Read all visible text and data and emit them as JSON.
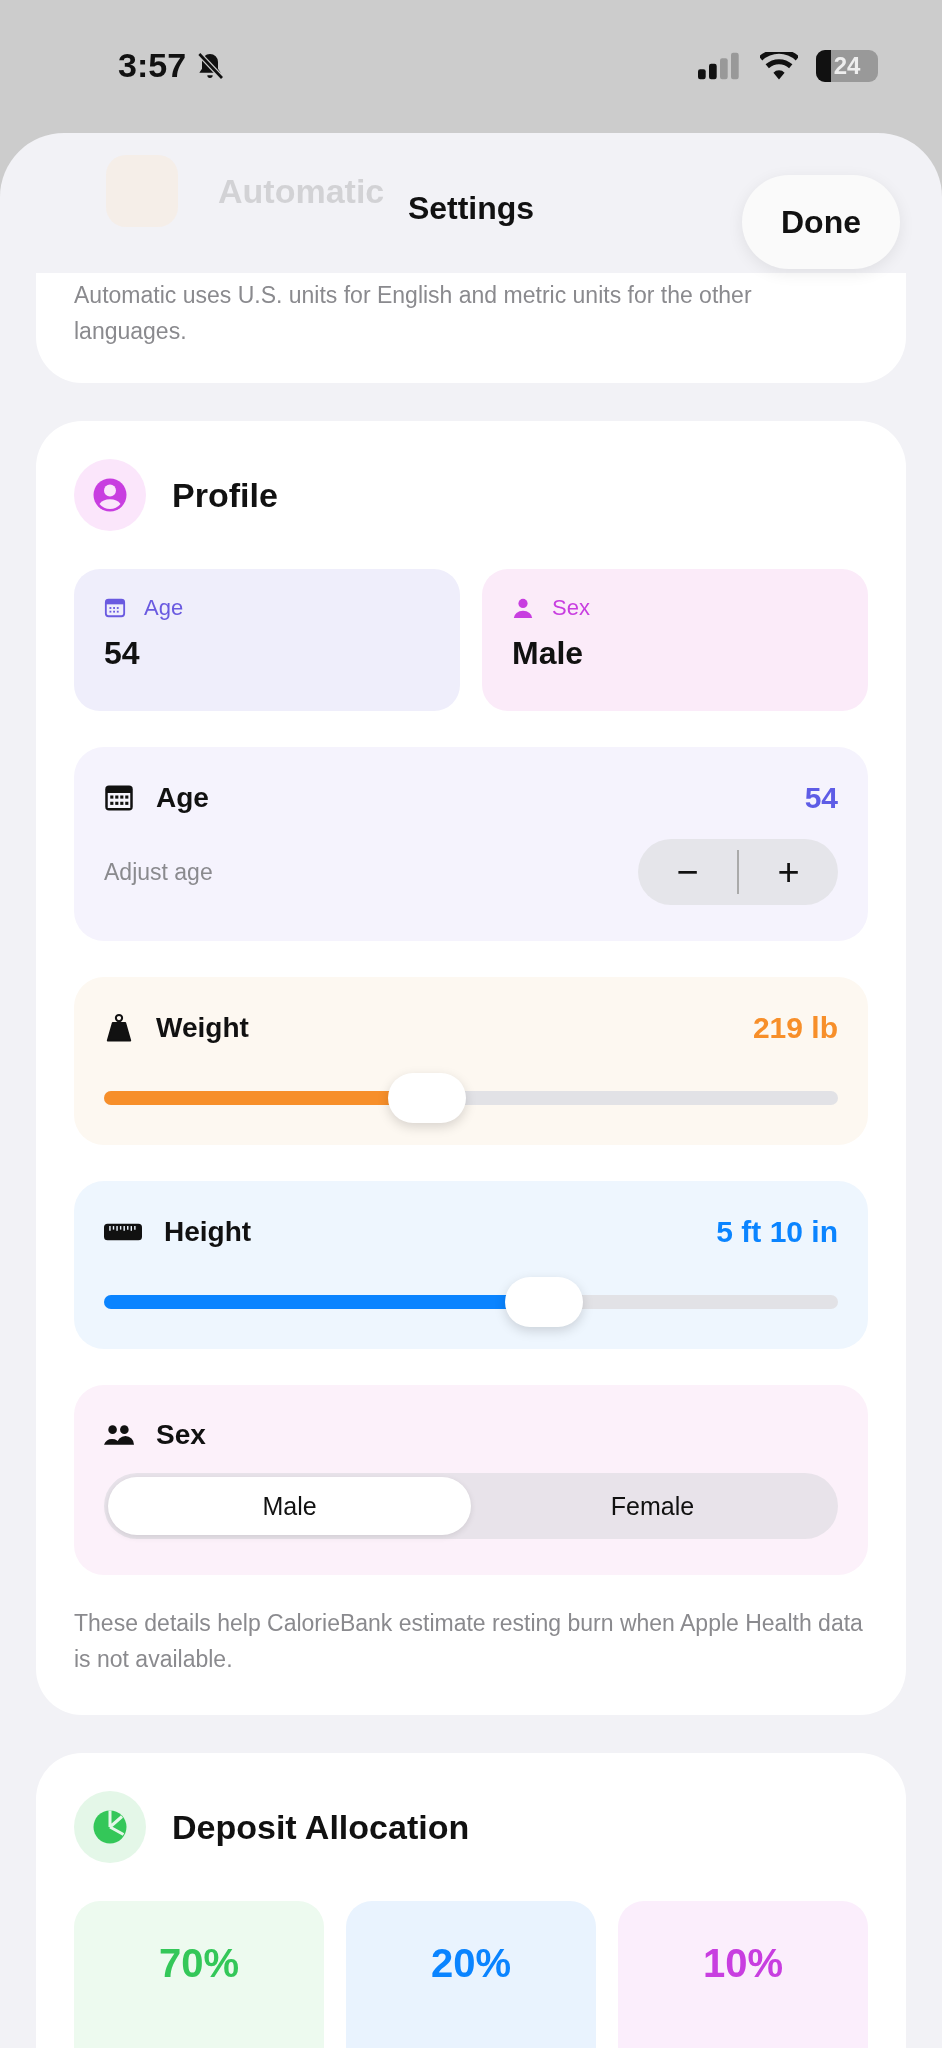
{
  "status_bar": {
    "time": "3:57",
    "battery": "24"
  },
  "header": {
    "title": "Settings",
    "done": "Done"
  },
  "units": {
    "value": "Automatic",
    "caption": "Automatic uses U.S. units for English and metric units for the other languages."
  },
  "profile": {
    "title": "Profile",
    "summary": [
      {
        "kind": "age",
        "label": "Age",
        "value": "54"
      },
      {
        "kind": "sex",
        "label": "Sex",
        "value": "Male"
      }
    ],
    "age": {
      "title": "Age",
      "value": "54",
      "hint": "Adjust age",
      "minus": "−",
      "plus": "+"
    },
    "sliders": [
      {
        "kind": "weight",
        "title": "Weight",
        "value": "219 lb",
        "level": 0.44
      },
      {
        "kind": "height",
        "title": "Height",
        "value": "5 ft 10 in",
        "level": 0.6
      }
    ],
    "sex": {
      "title": "Sex",
      "options": [
        {
          "label": "Male",
          "selected": true
        },
        {
          "label": "Female",
          "selected": false
        }
      ]
    },
    "footnote": "These details help CalorieBank estimate resting burn when Apple Health data is not available."
  },
  "deposit": {
    "title": "Deposit Allocation",
    "tiles": [
      {
        "value": "70%",
        "color": "#34c759"
      },
      {
        "value": "20%",
        "color": "#0a84ff"
      },
      {
        "value": "10%",
        "color": "#c83ee0"
      }
    ]
  }
}
